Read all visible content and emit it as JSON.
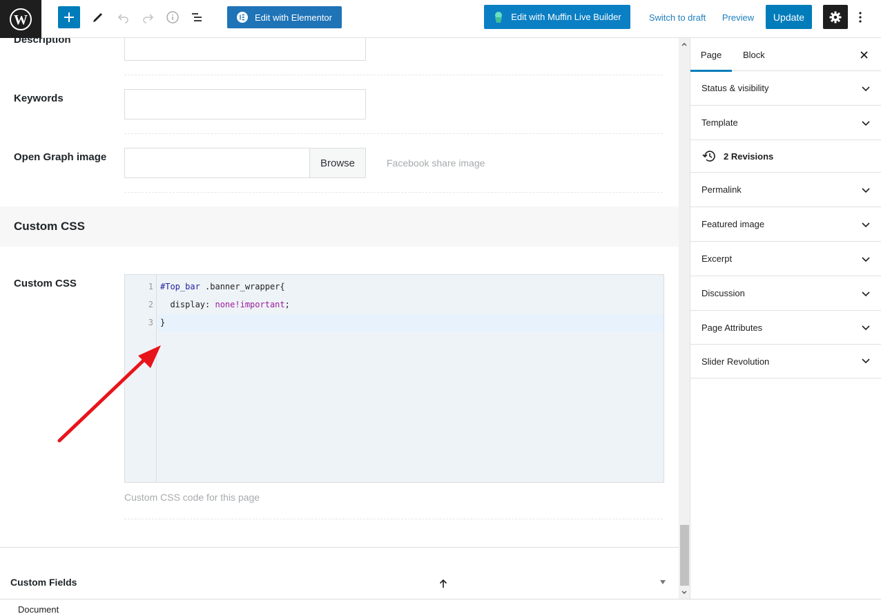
{
  "toolbar": {
    "elementor_label": "Edit with Elementor",
    "muffin_label": "Edit with Muffin Live Builder",
    "switch_draft": "Switch to draft",
    "preview": "Preview",
    "update": "Update"
  },
  "seo": {
    "description_label": "Description",
    "keywords_label": "Keywords",
    "og_label": "Open Graph image",
    "browse": "Browse",
    "og_hint": "Facebook share image"
  },
  "custom_css": {
    "section_title": "Custom CSS",
    "field_label": "Custom CSS",
    "line_numbers": [
      "1",
      "2",
      "3"
    ],
    "line1_selector": "#Top_bar",
    "line1_rest": " .banner_wrapper{",
    "line2_prop": "  display: ",
    "line2_value": "none!important",
    "line2_end": ";",
    "line3": "}",
    "hint": "Custom CSS code for this page"
  },
  "custom_fields": "Custom Fields",
  "sidebar": {
    "tab_page": "Page",
    "tab_block": "Block",
    "status_visibility": "Status & visibility",
    "template": "Template",
    "revisions": "2 Revisions",
    "permalink": "Permalink",
    "featured_image": "Featured image",
    "excerpt": "Excerpt",
    "discussion": "Discussion",
    "page_attributes": "Page Attributes",
    "slider_revolution": "Slider Revolution"
  },
  "footer": "Document",
  "colors": {
    "accent": "#007cba",
    "annotation_arrow": "#e8141b"
  }
}
